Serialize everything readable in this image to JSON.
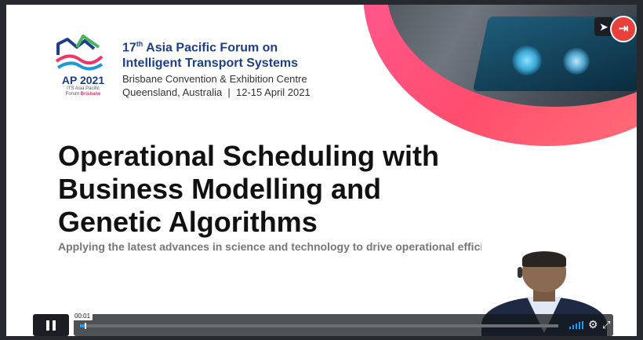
{
  "logo": {
    "label": "AP 2021",
    "sub1": "ITS Asia Pacific",
    "sub2_prefix": "Forum",
    "sub2_city": "Brisbane"
  },
  "header": {
    "forum_ordinal": "17",
    "forum_ordinal_suffix": "th",
    "forum_line1_rest": " Asia Pacific Forum on",
    "forum_line2": "Intelligent Transport Systems",
    "venue_line1": "Brisbane Convention & Exhibition Centre",
    "venue_line2": "Queensland, Australia  |  12-15 April 2021"
  },
  "slide": {
    "title_line1": "Operational Scheduling with",
    "title_line2": "Business Modelling and",
    "title_line3": "Genetic Algorithms",
    "subtitle": "Applying the latest advances in science and technology to drive operational efficiencies"
  },
  "player": {
    "time": "00:01",
    "progress_fraction": 0.01,
    "accent": "#1a9fff",
    "icons": {
      "play_pause": "pause-icon",
      "share": "send-icon",
      "exit": "exit-icon",
      "volume": "volume-icon",
      "settings": "gear-icon",
      "fullscreen": "fullscreen-icon"
    }
  }
}
